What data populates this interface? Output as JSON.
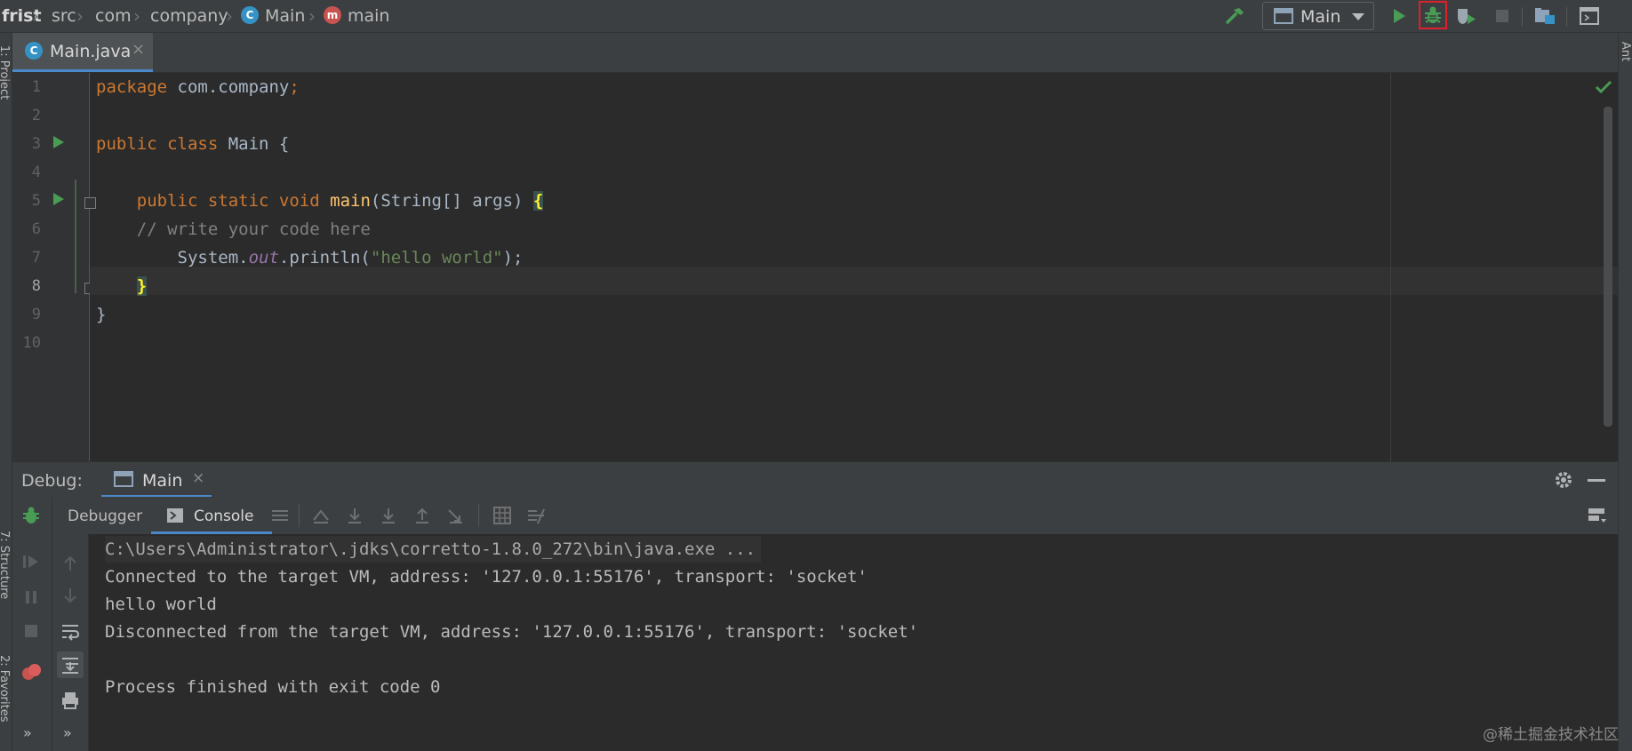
{
  "navbar": {
    "breadcrumbs": [
      "frist",
      "src",
      "com",
      "company",
      "Main",
      "main"
    ],
    "run_config": "Main",
    "icons": [
      "build-hammer-icon",
      "run-icon",
      "debug-icon",
      "run-with-coverage-icon",
      "stop-icon",
      "project-structure-icon",
      "presentation-icon"
    ],
    "highlight_color": "#e0202a"
  },
  "side_panels": {
    "left_top": "1: Project",
    "left_middle": "7: Structure",
    "left_bottom": "2: Favorites",
    "right_top": "Ant"
  },
  "editor": {
    "tab_label": "Main.java",
    "line_numbers": [
      "1",
      "2",
      "3",
      "4",
      "5",
      "6",
      "7",
      "8",
      "9",
      "10"
    ],
    "current_line": "8",
    "code": {
      "l1_kw": "package",
      "l1_rest": " com.company",
      "l1_semi": ";",
      "l3_kw": "public class",
      "l3_rest": " Main {",
      "l5_kw": "public static void",
      "l5_fn": "main",
      "l5_rest": "(String[] args) ",
      "l5_brace": "{",
      "l6_comment": "// write your code here",
      "l7_pre": "System.",
      "l7_field": "out",
      "l7_call": ".println(",
      "l7_str": "\"hello world\"",
      "l7_end": ");",
      "l8_brace": "}",
      "l9_brace": "}"
    }
  },
  "debug": {
    "title": "Debug:",
    "session_tab": "Main",
    "tab_debugger": "Debugger",
    "tab_console": "Console",
    "console_lines": [
      "C:\\Users\\Administrator\\.jdks\\corretto-1.8.0_272\\bin\\java.exe ...",
      "Connected to the target VM, address: '127.0.0.1:55176', transport: 'socket'",
      "hello world",
      "Disconnected from the target VM, address: '127.0.0.1:55176', transport: 'socket'",
      "",
      "Process finished with exit code 0"
    ]
  },
  "watermark": "@稀土掘金技术社区"
}
